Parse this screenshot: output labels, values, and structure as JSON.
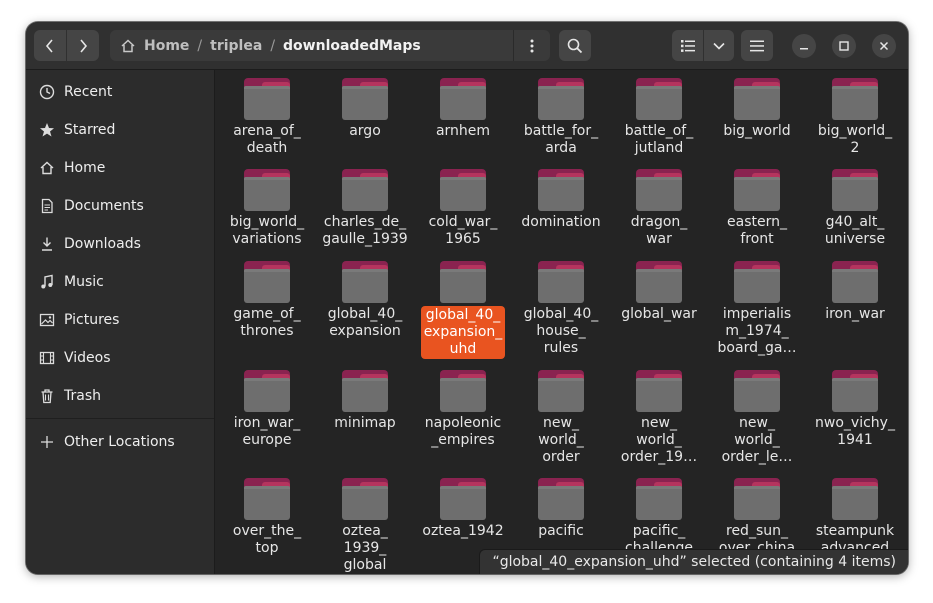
{
  "breadcrumb": {
    "home": "Home",
    "triplea": "triplea",
    "current": "downloadedMaps"
  },
  "sidebar": {
    "items": [
      {
        "label": "Recent",
        "icon": "clock-icon"
      },
      {
        "label": "Starred",
        "icon": "star-icon"
      },
      {
        "label": "Home",
        "icon": "home-icon"
      },
      {
        "label": "Documents",
        "icon": "document-icon"
      },
      {
        "label": "Downloads",
        "icon": "download-icon"
      },
      {
        "label": "Music",
        "icon": "music-icon"
      },
      {
        "label": "Pictures",
        "icon": "pictures-icon"
      },
      {
        "label": "Videos",
        "icon": "video-icon"
      },
      {
        "label": "Trash",
        "icon": "trash-icon"
      }
    ],
    "other": {
      "label": "Other Locations",
      "icon": "plus-icon"
    }
  },
  "files": [
    [
      "arena_of_\ndeath",
      "argo",
      "arnhem",
      "battle_for_\narda",
      "battle_of_\njutland",
      "big_world",
      "big_world_\n2"
    ],
    [
      "big_world_\nvariations",
      "charles_de_\ngaulle_1939",
      "cold_war_\n1965",
      "domination",
      "dragon_\nwar",
      "eastern_\nfront",
      "g40_alt_\nuniverse"
    ],
    [
      "game_of_\nthrones",
      "global_40_\nexpansion",
      "global_40_\nexpansion_\nuhd",
      "global_40_\nhouse_\nrules",
      "global_war",
      "imperialis\nm_1974_\nboard_ga…",
      "iron_war"
    ],
    [
      "iron_war_\neurope",
      "minimap",
      "napoleonic\n_empires",
      "new_\nworld_\norder",
      "new_\nworld_\norder_19…",
      "new_\nworld_\norder_le…",
      "nwo_vichy_\n1941"
    ],
    [
      "over_the_\ntop",
      "oztea_\n1939_\nglobal",
      "oztea_1942",
      "pacific",
      "pacific_\nchallenge",
      "red_sun_\nover_china",
      "steampunk\nadvanced"
    ]
  ],
  "selected": "global_40_\nexpansion_\nuhd",
  "status_text": "“global_40_expansion_uhd” selected  (containing 4 items)",
  "colors": {
    "accent": "#e95420",
    "folder_tab": "#8a2350",
    "folder_body": "#6e6e6e"
  }
}
